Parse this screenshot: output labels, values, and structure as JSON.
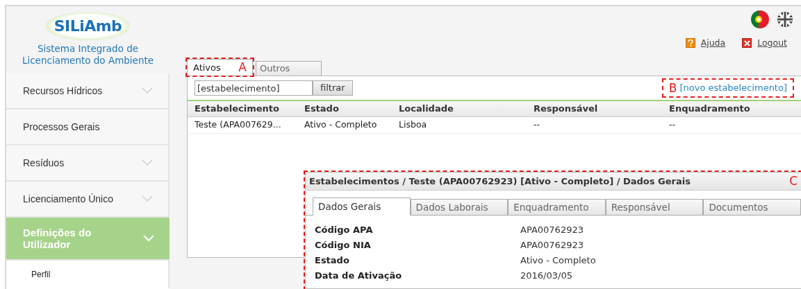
{
  "logo": {
    "name": "SILiAmb",
    "subtitle": "Sistema Integrado de Licenciamento do Ambiente"
  },
  "header": {
    "languages": [
      {
        "kind": "pt",
        "selected": true
      },
      {
        "kind": "uk",
        "selected": false
      }
    ],
    "links": [
      {
        "kind": "help",
        "label": "Ajuda"
      },
      {
        "kind": "logout",
        "label": "Logout"
      }
    ]
  },
  "sidebar": {
    "items": [
      {
        "label": "Recursos Hídricos",
        "expanded": false,
        "has_caret": true
      },
      {
        "label": "Processos Gerais",
        "expanded": false,
        "has_caret": false
      },
      {
        "label": "Resíduos",
        "expanded": false,
        "has_caret": true
      },
      {
        "label": "Licenciamento Único",
        "expanded": false,
        "has_caret": true
      },
      {
        "label": "Definições do Utilizador",
        "expanded": true,
        "has_caret": true,
        "children": [
          {
            "label": "Perfil"
          }
        ]
      }
    ]
  },
  "tabs": [
    {
      "label": "Ativos",
      "selected": true,
      "annotation": "A"
    },
    {
      "label": "Outros",
      "selected": false
    }
  ],
  "filter": {
    "value": "[estabelecimento]",
    "button": "filtrar"
  },
  "new_link": {
    "label": "[novo estabelecimento]",
    "annotation": "B"
  },
  "table": {
    "columns": [
      "Estabelecimento",
      "Estado",
      "Localidade",
      "Responsável",
      "Enquadramento"
    ],
    "rows": [
      [
        "Teste (APA007629...",
        "Ativo - Completo",
        "Lisboa",
        "--",
        "--"
      ]
    ]
  },
  "detail": {
    "annotation": "C",
    "title": "Estabelecimentos / Teste (APA00762923) [Ativo - Completo] / Dados Gerais",
    "tabs": [
      {
        "label": "Dados Gerais",
        "selected": true
      },
      {
        "label": "Dados Laborais",
        "selected": false
      },
      {
        "label": "Enquadramento",
        "selected": false
      },
      {
        "label": "Responsável",
        "selected": false
      },
      {
        "label": "Documentos",
        "selected": false
      }
    ],
    "fields": [
      {
        "label": "Código APA",
        "value": "APA00762923"
      },
      {
        "label": "Código NIA",
        "value": "APA00762923"
      },
      {
        "label": "Estado",
        "value": "Ativo - Completo"
      },
      {
        "label": "Data de Ativação",
        "value": "2016/03/05"
      }
    ]
  }
}
